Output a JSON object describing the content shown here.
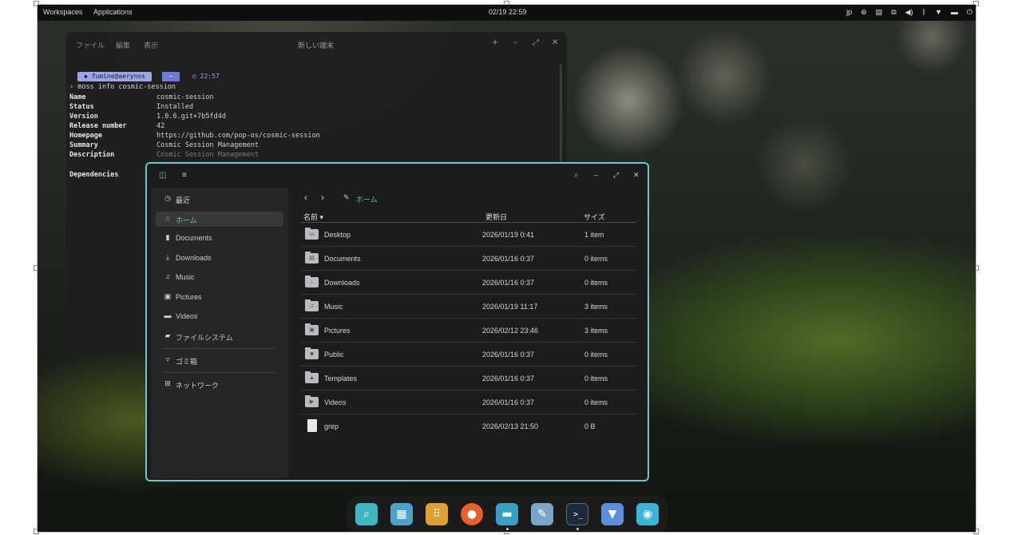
{
  "panel": {
    "workspaces": "Workspaces",
    "applications": "Applications",
    "clock": "02/19 22:59",
    "input_method": "jp",
    "tray_icons": [
      "accessibility-icon",
      "keyboard-icon",
      "network-wired-icon",
      "volume-icon",
      "bluetooth-icon",
      "wifi-icon",
      "notifications-icon",
      "power-icon"
    ]
  },
  "terminal": {
    "menu": [
      "ファイル",
      "編集",
      "表示"
    ],
    "title": "新しい端末",
    "prompt_user": "fumine@aerynos",
    "prompt_dir": "~",
    "prompt_time": "22:57",
    "command": "› moss info cosmic-session",
    "info": [
      {
        "key": "Name",
        "value": "cosmic-session"
      },
      {
        "key": "Status",
        "value": "Installed"
      },
      {
        "key": "Version",
        "value": "1.0.6.git+7b5fd4d"
      },
      {
        "key": "Release number",
        "value": "42"
      },
      {
        "key": "Homepage",
        "value": "https://github.com/pop-os/cosmic-session"
      },
      {
        "key": "Summary",
        "value": "Cosmic Session Management"
      },
      {
        "key": "Description",
        "value": "Cosmic Session Management"
      }
    ],
    "dependencies_label": "Dependencies"
  },
  "files": {
    "sidebar": [
      {
        "label": "最近",
        "icon": "clock-icon",
        "glyph": "◷"
      },
      {
        "label": "ホーム",
        "icon": "home-icon",
        "glyph": "⌂",
        "active": true
      },
      {
        "label": "Documents",
        "icon": "document-icon",
        "glyph": "▮"
      },
      {
        "label": "Downloads",
        "icon": "download-icon",
        "glyph": "⤓"
      },
      {
        "label": "Music",
        "icon": "music-icon",
        "glyph": "♫"
      },
      {
        "label": "Pictures",
        "icon": "picture-icon",
        "glyph": "▣"
      },
      {
        "label": "Videos",
        "icon": "video-icon",
        "glyph": "▬"
      },
      {
        "label": "ファイルシステム",
        "icon": "folder-icon",
        "glyph": "▰"
      },
      {
        "label": "ゴミ箱",
        "icon": "trash-icon",
        "glyph": "▿"
      },
      {
        "label": "ネットワーク",
        "icon": "network-icon",
        "glyph": "⊞"
      }
    ],
    "path": "ホーム",
    "columns": {
      "name": "名前",
      "modified": "更新日",
      "size": "サイズ"
    },
    "rows": [
      {
        "name": "Desktop",
        "modified": "2026/01/19 0:41",
        "size": "1 item",
        "icon": "folder-desktop-icon",
        "glyph": "▭"
      },
      {
        "name": "Documents",
        "modified": "2026/01/16 0:37",
        "size": "0 items",
        "icon": "folder-documents-icon",
        "glyph": "▤"
      },
      {
        "name": "Downloads",
        "modified": "2026/01/16 0:37",
        "size": "0 items",
        "icon": "folder-downloads-icon",
        "glyph": "↓"
      },
      {
        "name": "Music",
        "modified": "2026/01/19 11:17",
        "size": "3 items",
        "icon": "folder-music-icon",
        "glyph": "♫"
      },
      {
        "name": "Pictures",
        "modified": "2026/02/12 23:46",
        "size": "3 items",
        "icon": "folder-pictures-icon",
        "glyph": "▣"
      },
      {
        "name": "Public",
        "modified": "2026/01/16 0:37",
        "size": "0 items",
        "icon": "folder-public-icon",
        "glyph": "☻"
      },
      {
        "name": "Templates",
        "modified": "2026/01/16 0:37",
        "size": "0 items",
        "icon": "folder-templates-icon",
        "glyph": "▲"
      },
      {
        "name": "Videos",
        "modified": "2026/01/16 0:37",
        "size": "0 items",
        "icon": "folder-videos-icon",
        "glyph": "▶"
      },
      {
        "name": "grep",
        "modified": "2026/02/13 21:50",
        "size": "0 B",
        "icon": "file-icon",
        "glyph": ""
      }
    ]
  },
  "dock": [
    {
      "name": "launcher-app-icon",
      "color": "#3fb6c6",
      "glyph": "⌕"
    },
    {
      "name": "workspaces-app-icon",
      "color": "#4da3c7",
      "glyph": "▦"
    },
    {
      "name": "app-library-icon",
      "color": "#e0a030",
      "glyph": "⠿"
    },
    {
      "name": "firefox-app-icon",
      "color": "#e8602c",
      "glyph": "●"
    },
    {
      "name": "files-app-icon",
      "color": "#3a9fc4",
      "glyph": "▬",
      "active": true
    },
    {
      "name": "text-editor-app-icon",
      "color": "#7aa6c8",
      "glyph": "✎"
    },
    {
      "name": "terminal-app-icon",
      "color": "#1d2a3a",
      "glyph": ">_",
      "active": true
    },
    {
      "name": "store-app-icon",
      "color": "#5b8fd9",
      "glyph": "▼"
    },
    {
      "name": "settings-app-icon",
      "color": "#3ab4d8",
      "glyph": "◉"
    }
  ]
}
